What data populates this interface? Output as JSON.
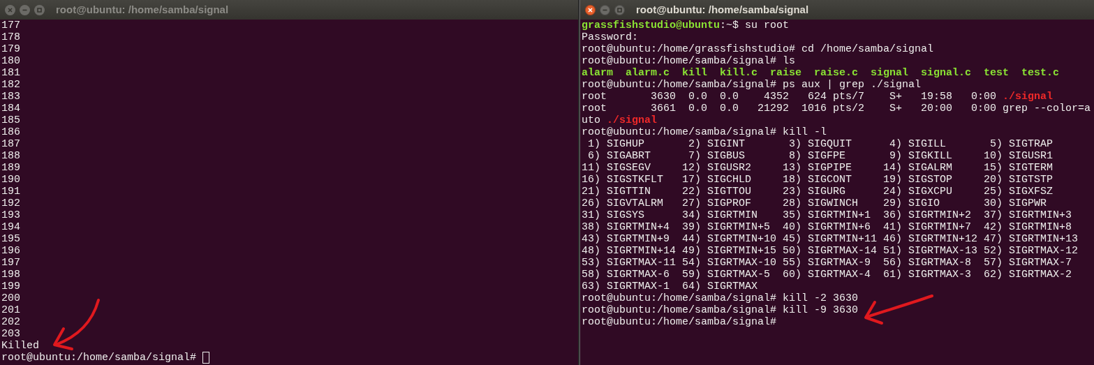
{
  "windows": [
    {
      "title": "root@ubuntu: /home/samba/signal",
      "active": false,
      "cursor": true,
      "lines": [
        {
          "segments": [
            {
              "text": "177",
              "kind": "plain"
            }
          ]
        },
        {
          "segments": [
            {
              "text": "178",
              "kind": "plain"
            }
          ]
        },
        {
          "segments": [
            {
              "text": "179",
              "kind": "plain"
            }
          ]
        },
        {
          "segments": [
            {
              "text": "180",
              "kind": "plain"
            }
          ]
        },
        {
          "segments": [
            {
              "text": "181",
              "kind": "plain"
            }
          ]
        },
        {
          "segments": [
            {
              "text": "182",
              "kind": "plain"
            }
          ]
        },
        {
          "segments": [
            {
              "text": "183",
              "kind": "plain"
            }
          ]
        },
        {
          "segments": [
            {
              "text": "184",
              "kind": "plain"
            }
          ]
        },
        {
          "segments": [
            {
              "text": "185",
              "kind": "plain"
            }
          ]
        },
        {
          "segments": [
            {
              "text": "186",
              "kind": "plain"
            }
          ]
        },
        {
          "segments": [
            {
              "text": "187",
              "kind": "plain"
            }
          ]
        },
        {
          "segments": [
            {
              "text": "188",
              "kind": "plain"
            }
          ]
        },
        {
          "segments": [
            {
              "text": "189",
              "kind": "plain"
            }
          ]
        },
        {
          "segments": [
            {
              "text": "190",
              "kind": "plain"
            }
          ]
        },
        {
          "segments": [
            {
              "text": "191",
              "kind": "plain"
            }
          ]
        },
        {
          "segments": [
            {
              "text": "192",
              "kind": "plain"
            }
          ]
        },
        {
          "segments": [
            {
              "text": "193",
              "kind": "plain"
            }
          ]
        },
        {
          "segments": [
            {
              "text": "194",
              "kind": "plain"
            }
          ]
        },
        {
          "segments": [
            {
              "text": "195",
              "kind": "plain"
            }
          ]
        },
        {
          "segments": [
            {
              "text": "196",
              "kind": "plain"
            }
          ]
        },
        {
          "segments": [
            {
              "text": "197",
              "kind": "plain"
            }
          ]
        },
        {
          "segments": [
            {
              "text": "198",
              "kind": "plain"
            }
          ]
        },
        {
          "segments": [
            {
              "text": "199",
              "kind": "plain"
            }
          ]
        },
        {
          "segments": [
            {
              "text": "200",
              "kind": "plain"
            }
          ]
        },
        {
          "segments": [
            {
              "text": "201",
              "kind": "plain"
            }
          ]
        },
        {
          "segments": [
            {
              "text": "202",
              "kind": "plain"
            }
          ]
        },
        {
          "segments": [
            {
              "text": "203",
              "kind": "plain"
            }
          ]
        },
        {
          "segments": [
            {
              "text": "Killed",
              "kind": "plain"
            }
          ]
        },
        {
          "segments": [
            {
              "text": "root@ubuntu:/home/samba/signal# ",
              "kind": "plain"
            }
          ]
        }
      ]
    },
    {
      "title": "root@ubuntu: /home/samba/signal",
      "active": true,
      "cursor": false,
      "lines": [
        {
          "segments": [
            {
              "text": "grassfishstudio@ubuntu",
              "kind": "green"
            },
            {
              "text": ":~$ su root",
              "kind": "plain"
            }
          ]
        },
        {
          "segments": [
            {
              "text": "Password:",
              "kind": "plain"
            }
          ]
        },
        {
          "segments": [
            {
              "text": "root@ubuntu:/home/grassfishstudio# cd /home/samba/signal",
              "kind": "plain"
            }
          ]
        },
        {
          "segments": [
            {
              "text": "root@ubuntu:/home/samba/signal# ls",
              "kind": "plain"
            }
          ]
        },
        {
          "segments": [
            {
              "text": "alarm  alarm.c  kill  kill.c  raise  raise.c  signal  signal.c  test  test.c",
              "kind": "green"
            }
          ]
        },
        {
          "segments": [
            {
              "text": "root@ubuntu:/home/samba/signal# ps aux | grep ./signal",
              "kind": "plain"
            }
          ]
        },
        {
          "segments": [
            {
              "text": "root       3630  0.0  0.0    4352   624 pts/7    S+   19:58   0:00 ",
              "kind": "plain"
            },
            {
              "text": "./signal",
              "kind": "red"
            }
          ]
        },
        {
          "segments": [
            {
              "text": "root       3661  0.0  0.0   21292  1016 pts/2    S+   20:00   0:00 grep --color=a",
              "kind": "plain"
            }
          ]
        },
        {
          "segments": [
            {
              "text": "uto ",
              "kind": "plain"
            },
            {
              "text": "./signal",
              "kind": "red"
            }
          ]
        },
        {
          "segments": [
            {
              "text": "root@ubuntu:/home/samba/signal# kill -l",
              "kind": "plain"
            }
          ]
        },
        {
          "segments": [
            {
              "text": " 1) SIGHUP       2) SIGINT       3) SIGQUIT      4) SIGILL       5) SIGTRAP",
              "kind": "plain"
            }
          ]
        },
        {
          "segments": [
            {
              "text": " 6) SIGABRT      7) SIGBUS       8) SIGFPE       9) SIGKILL     10) SIGUSR1",
              "kind": "plain"
            }
          ]
        },
        {
          "segments": [
            {
              "text": "11) SIGSEGV     12) SIGUSR2     13) SIGPIPE     14) SIGALRM     15) SIGTERM",
              "kind": "plain"
            }
          ]
        },
        {
          "segments": [
            {
              "text": "16) SIGSTKFLT   17) SIGCHLD     18) SIGCONT     19) SIGSTOP     20) SIGTSTP",
              "kind": "plain"
            }
          ]
        },
        {
          "segments": [
            {
              "text": "21) SIGTTIN     22) SIGTTOU     23) SIGURG      24) SIGXCPU     25) SIGXFSZ",
              "kind": "plain"
            }
          ]
        },
        {
          "segments": [
            {
              "text": "26) SIGVTALRM   27) SIGPROF     28) SIGWINCH    29) SIGIO       30) SIGPWR",
              "kind": "plain"
            }
          ]
        },
        {
          "segments": [
            {
              "text": "31) SIGSYS      34) SIGRTMIN    35) SIGRTMIN+1  36) SIGRTMIN+2  37) SIGRTMIN+3",
              "kind": "plain"
            }
          ]
        },
        {
          "segments": [
            {
              "text": "38) SIGRTMIN+4  39) SIGRTMIN+5  40) SIGRTMIN+6  41) SIGRTMIN+7  42) SIGRTMIN+8",
              "kind": "plain"
            }
          ]
        },
        {
          "segments": [
            {
              "text": "43) SIGRTMIN+9  44) SIGRTMIN+10 45) SIGRTMIN+11 46) SIGRTMIN+12 47) SIGRTMIN+13",
              "kind": "plain"
            }
          ]
        },
        {
          "segments": [
            {
              "text": "48) SIGRTMIN+14 49) SIGRTMIN+15 50) SIGRTMAX-14 51) SIGRTMAX-13 52) SIGRTMAX-12",
              "kind": "plain"
            }
          ]
        },
        {
          "segments": [
            {
              "text": "53) SIGRTMAX-11 54) SIGRTMAX-10 55) SIGRTMAX-9  56) SIGRTMAX-8  57) SIGRTMAX-7",
              "kind": "plain"
            }
          ]
        },
        {
          "segments": [
            {
              "text": "58) SIGRTMAX-6  59) SIGRTMAX-5  60) SIGRTMAX-4  61) SIGRTMAX-3  62) SIGRTMAX-2",
              "kind": "plain"
            }
          ]
        },
        {
          "segments": [
            {
              "text": "63) SIGRTMAX-1  64) SIGRTMAX",
              "kind": "plain"
            }
          ]
        },
        {
          "segments": [
            {
              "text": "root@ubuntu:/home/samba/signal# kill -2 3630",
              "kind": "plain"
            }
          ]
        },
        {
          "segments": [
            {
              "text": "root@ubuntu:/home/samba/signal# kill -9 3630",
              "kind": "plain"
            }
          ]
        },
        {
          "segments": [
            {
              "text": "root@ubuntu:/home/samba/signal#",
              "kind": "plain"
            }
          ]
        }
      ]
    }
  ]
}
